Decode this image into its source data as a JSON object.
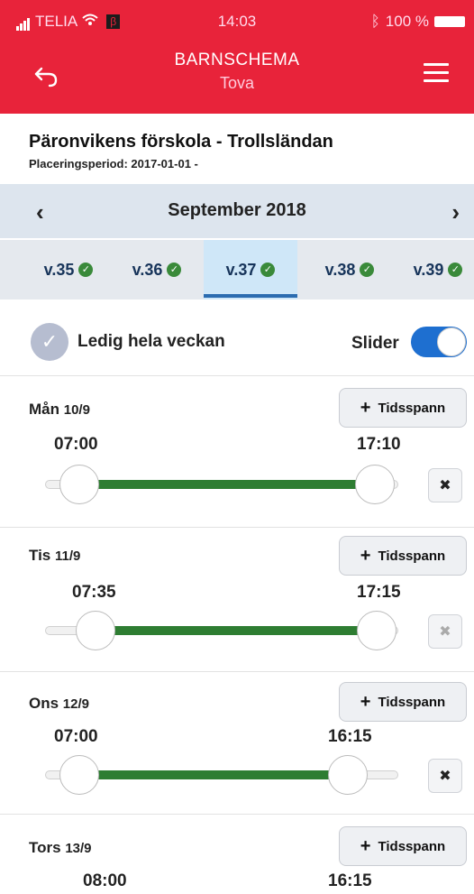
{
  "status_bar": {
    "carrier": "TELIA",
    "beta": "β",
    "time": "14:03",
    "battery": "100 %"
  },
  "header": {
    "title": "BARNSCHEMA",
    "subtitle": "Tova",
    "bg_color": "#e8233a"
  },
  "placement": {
    "name": "Päronvikens förskola - Trollsländan",
    "period": "Placeringsperiod: 2017-01-01 -"
  },
  "month": {
    "prev": "‹",
    "label": "September 2018",
    "next": "›"
  },
  "weeks": [
    {
      "label": "v.35",
      "check": "✓"
    },
    {
      "label": "v.36",
      "check": "✓"
    },
    {
      "label": "v.37",
      "check": "✓",
      "selected": true
    },
    {
      "label": "v.38",
      "check": "✓"
    },
    {
      "label": "v.39",
      "check": "✓"
    }
  ],
  "ledig": {
    "label": "Ledig hela veckan",
    "check": "✓"
  },
  "slider_toggle": {
    "label": "Slider",
    "on": true
  },
  "add_label": "Tidsspann",
  "add_icon": "+",
  "remove_icon": "✖",
  "days": [
    {
      "day": "Mån",
      "date": "10/9",
      "start": "07:00",
      "end": "17:10"
    },
    {
      "day": "Tis",
      "date": "11/9",
      "start": "07:35",
      "end": "17:15"
    },
    {
      "day": "Ons",
      "date": "12/9",
      "start": "07:00",
      "end": "16:15"
    },
    {
      "day": "Tors",
      "date": "13/9",
      "start": "08:00",
      "end": "16:15"
    }
  ],
  "colors": {
    "accent": "#1e6fd0",
    "fill": "#2e7d32",
    "check": "#3a8a3a"
  }
}
